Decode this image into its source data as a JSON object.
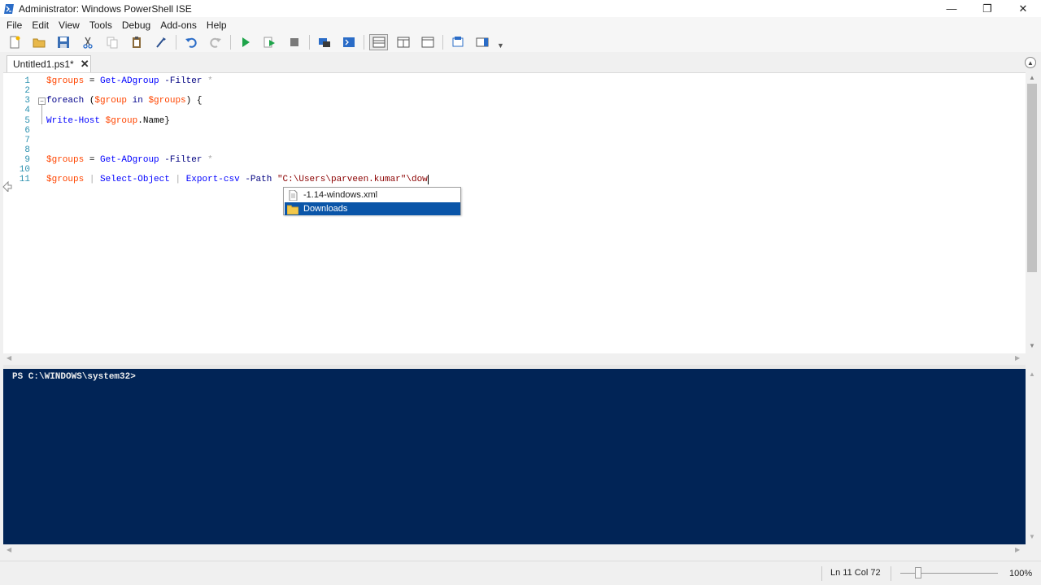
{
  "window": {
    "title": "Administrator: Windows PowerShell ISE",
    "minimize": "—",
    "restore": "❐",
    "close": "✕"
  },
  "menu": [
    "File",
    "Edit",
    "View",
    "Tools",
    "Debug",
    "Add-ons",
    "Help"
  ],
  "toolbar": {
    "icons": [
      "new-icon",
      "open-icon",
      "save-icon",
      "cut-icon",
      "copy-icon",
      "paste-icon",
      "clear-icon",
      "undo-icon",
      "redo-icon",
      "run-icon",
      "run-selection-icon",
      "stop-icon",
      "remote-powershell-icon",
      "console-icon",
      "layout-top-icon",
      "layout-right-icon",
      "layout-max-icon",
      "show-script-icon",
      "commands-addon-icon"
    ]
  },
  "tab": {
    "label": "Untitled1.ps1*",
    "close": "✕"
  },
  "editor": {
    "lines": [
      {
        "n": "1",
        "tokens": [
          [
            "var",
            "$groups"
          ],
          [
            "plain",
            " = "
          ],
          [
            "cmd",
            "Get-ADgroup"
          ],
          [
            "plain",
            " "
          ],
          [
            "param",
            "-Filter"
          ],
          [
            "plain",
            " "
          ],
          [
            "op",
            "*"
          ]
        ]
      },
      {
        "n": "2",
        "tokens": []
      },
      {
        "n": "3",
        "tokens": [
          [
            "kw",
            "foreach"
          ],
          [
            "plain",
            " ("
          ],
          [
            "var",
            "$group"
          ],
          [
            "plain",
            " "
          ],
          [
            "kw",
            "in"
          ],
          [
            "plain",
            " "
          ],
          [
            "var",
            "$groups"
          ],
          [
            "plain",
            ") {"
          ]
        ]
      },
      {
        "n": "4",
        "tokens": []
      },
      {
        "n": "5",
        "tokens": [
          [
            "cmd",
            "Write-Host"
          ],
          [
            "plain",
            " "
          ],
          [
            "var",
            "$group"
          ],
          [
            "plain",
            "."
          ],
          [
            "member",
            "Name"
          ],
          [
            "plain",
            "}"
          ]
        ]
      },
      {
        "n": "6",
        "tokens": []
      },
      {
        "n": "7",
        "tokens": []
      },
      {
        "n": "8",
        "tokens": []
      },
      {
        "n": "9",
        "tokens": [
          [
            "var",
            "$groups"
          ],
          [
            "plain",
            " = "
          ],
          [
            "cmd",
            "Get-ADgroup"
          ],
          [
            "plain",
            " "
          ],
          [
            "param",
            "-Filter"
          ],
          [
            "plain",
            " "
          ],
          [
            "op",
            "*"
          ]
        ]
      },
      {
        "n": "10",
        "tokens": []
      },
      {
        "n": "11",
        "tokens": [
          [
            "var",
            "$groups"
          ],
          [
            "plain",
            " "
          ],
          [
            "op",
            "|"
          ],
          [
            "plain",
            " "
          ],
          [
            "cmd",
            "Select-Object"
          ],
          [
            "plain",
            " "
          ],
          [
            "op",
            "|"
          ],
          [
            "plain",
            " "
          ],
          [
            "cmd",
            "Export-csv"
          ],
          [
            "plain",
            " "
          ],
          [
            "param",
            "-Path"
          ],
          [
            "plain",
            " "
          ],
          [
            "str",
            "\"C:\\Users\\parveen.kumar\"\\dow"
          ]
        ]
      }
    ]
  },
  "autocomplete": {
    "items": [
      {
        "label": "-1.14-windows.xml",
        "icon": "file-icon",
        "selected": false
      },
      {
        "label": "Downloads",
        "icon": "folder-icon",
        "selected": true
      }
    ]
  },
  "console": {
    "prompt": "PS C:\\WINDOWS\\system32>"
  },
  "status": {
    "position": "Ln 11  Col 72",
    "zoom": "100%",
    "zoom_level": 0.18
  },
  "colors": {
    "console_bg": "#012456",
    "selection": "#0a55a8",
    "variable": "#ff4500",
    "command": "#0000ff",
    "keyword": "#00008b",
    "string": "#8b0000",
    "line_number": "#2b91af"
  }
}
